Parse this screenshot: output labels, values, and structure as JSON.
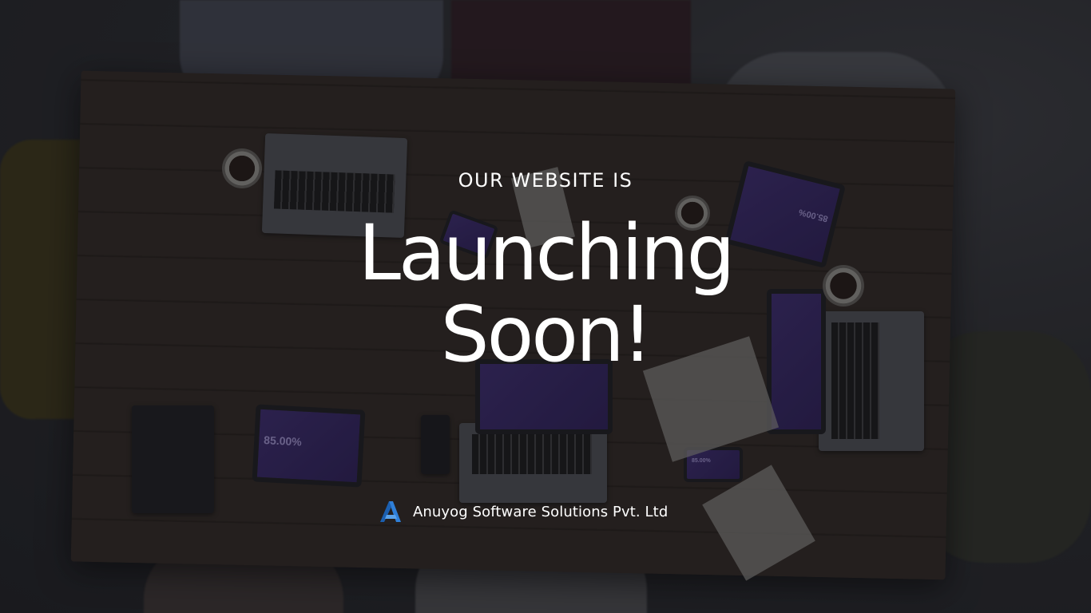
{
  "hero": {
    "pre_heading": "OUR WEBSITE IS",
    "headline_line1": "Launching",
    "headline_line2": "Soon!"
  },
  "brand": {
    "name": "Anuyog Software Solutions Pvt. Ltd",
    "logo_icon": "triangle-a-logo",
    "accent_color": "#2f7fd8"
  },
  "background": {
    "description_icon": "team-meeting-photo",
    "screen_values": [
      "85.00%",
      "85.00%",
      "85.00%"
    ]
  }
}
